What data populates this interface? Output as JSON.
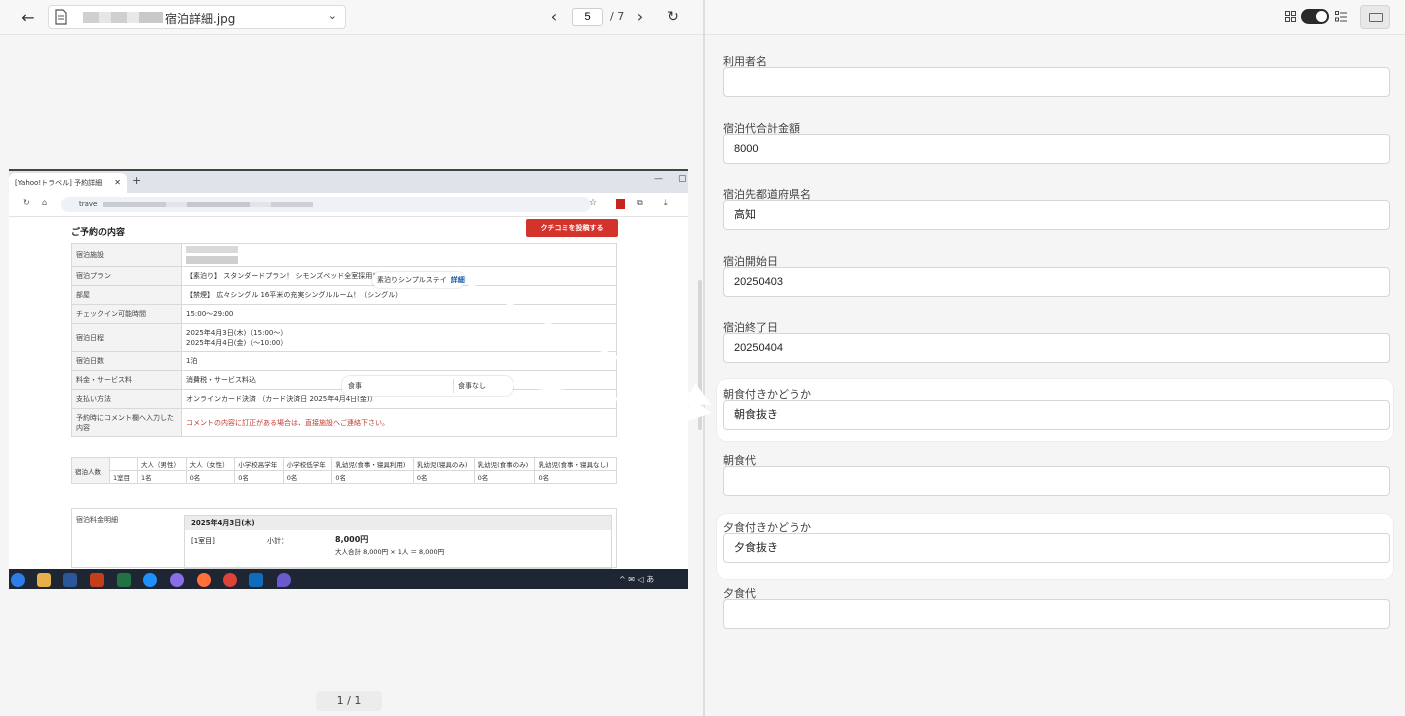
{
  "viewer": {
    "file_name": "宿泊詳細.jpg",
    "current_page": "5",
    "total_pages": "/ 7",
    "page_indicator": "1 / 1"
  },
  "screenshot": {
    "tab_title": "[Yahoo!トラベル] 予約詳細",
    "url_prefix": "trave",
    "section_title": "ご予約の内容",
    "review_button": "クチコミを投稿する",
    "rows": [
      {
        "label": "宿泊施設",
        "value": ""
      },
      {
        "label": "宿泊プラン",
        "value": "【素泊り】 スタンダードプラン！ シモンズベッド全室採用！"
      },
      {
        "label": "部屋",
        "value": "【禁煙】 広々シングル 16平米の充実シングルルーム！（シングル）"
      },
      {
        "label": "チェックイン可能時間",
        "value": "15:00〜29:00"
      },
      {
        "label": "宿泊日程",
        "value": "2025年4月3日(木)（15:00〜）",
        "value2": "2025年4月4日(金)（〜10:00）"
      },
      {
        "label": "宿泊日数",
        "value": "1泊"
      },
      {
        "label": "料金・サービス料",
        "value": "消費税・サービス料込"
      },
      {
        "label": "支払い方法",
        "value": "オンラインカード決済 （カード決済日 2025年4月4日(金)）"
      },
      {
        "label": "予約時にコメント欄へ入力した内容",
        "value": "コメントの内容に訂正がある場合は、直接施設へご連絡下さい。"
      }
    ],
    "people": {
      "label": "宿泊人数",
      "headers": [
        "大人（男性）",
        "大人（女性）",
        "小学校高学年",
        "小学校低学年",
        "乳幼児(食事・寝具利用)",
        "乳幼児(寝具のみ)",
        "乳幼児(食事のみ)",
        "乳幼児(食事・寝具なし)"
      ],
      "room": "1室目",
      "values": [
        "1名",
        "0名",
        "0名",
        "0名",
        "0名",
        "0名",
        "0名",
        "0名"
      ]
    },
    "price": {
      "label": "宿泊料金明細",
      "date": "2025年4月3日(木)",
      "room": "[1室目]",
      "subtotal_label": "小計：",
      "amount": "8,000円",
      "detail": "大人合計 8,000円 × 1人 ＝ 8,000円"
    },
    "callout_plan": {
      "text": "素泊りシンプルステイ",
      "detail": "詳細"
    },
    "callout_meal": {
      "key": "食事",
      "value": "食事なし"
    }
  },
  "form": {
    "fields": [
      {
        "label": "利用者名",
        "value": ""
      },
      {
        "label": "宿泊代合計金額",
        "value": "8000"
      },
      {
        "label": "宿泊先都道府県名",
        "value": "高知"
      },
      {
        "label": "宿泊開始日",
        "value": "20250403"
      },
      {
        "label": "宿泊終了日",
        "value": "20250404"
      },
      {
        "label": "朝食付きかどうか",
        "value": "朝食抜き"
      },
      {
        "label": "朝食代",
        "value": ""
      },
      {
        "label": "夕食付きかどうか",
        "value": "夕食抜き"
      },
      {
        "label": "夕食代",
        "value": ""
      }
    ]
  },
  "colors": {
    "accent_red": "#d3332b",
    "toggle": "#2a2a2a"
  }
}
